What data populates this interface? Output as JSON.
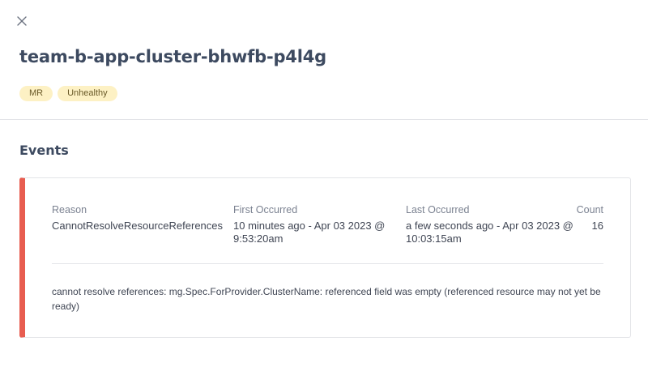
{
  "header": {
    "close_icon": "close-icon",
    "title": "team-b-app-cluster-bhwfb-p4l4g",
    "badges": [
      {
        "label": "MR",
        "color": "#fdf1c4"
      },
      {
        "label": "Unhealthy",
        "color": "#fdf1c4"
      }
    ]
  },
  "events": {
    "section_title": "Events",
    "accent_color": "#e85d50",
    "columns": {
      "reason": "Reason",
      "first_occurred": "First Occurred",
      "last_occurred": "Last Occurred",
      "count": "Count"
    },
    "items": [
      {
        "reason": "CannotResolveResourceReferences",
        "first_occurred": "10 minutes ago - Apr 03 2023 @ 9:53:20am",
        "last_occurred": "a few seconds ago - Apr 03 2023 @ 10:03:15am",
        "count": "16",
        "message": "cannot resolve references: mg.Spec.ForProvider.ClusterName: referenced field was empty (referenced resource may not yet be ready)"
      }
    ]
  }
}
